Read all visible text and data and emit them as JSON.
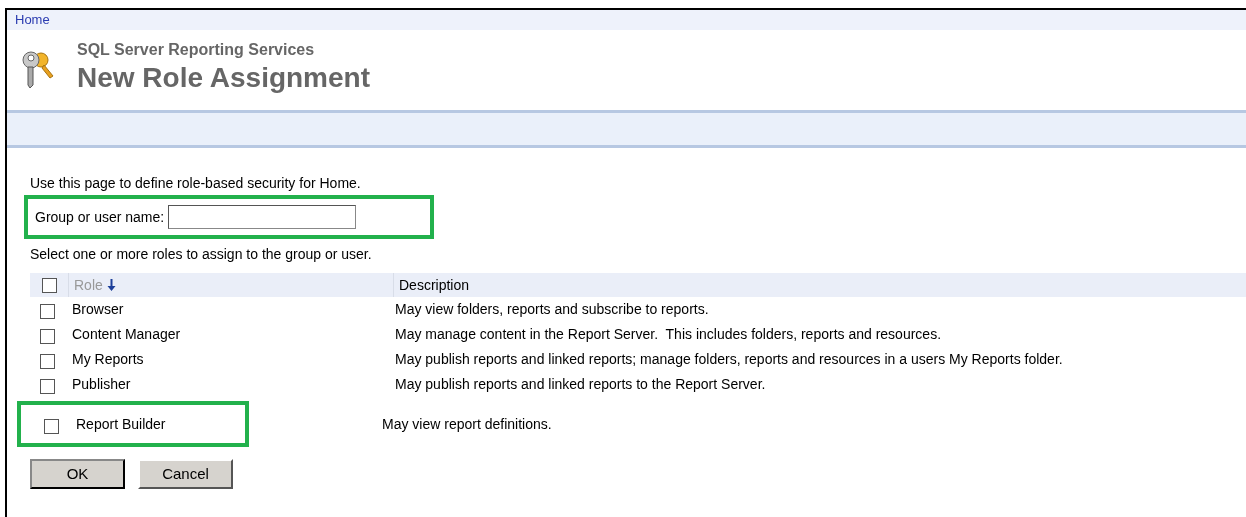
{
  "breadcrumb": "Home",
  "header": {
    "product": "SQL Server Reporting Services",
    "title": "New Role Assignment"
  },
  "intro": "Use this page to define role-based security for Home.",
  "user_field": {
    "label": "Group or user name:",
    "highlighted": true
  },
  "instruction": "Select one or more roles to assign to the group or user.",
  "table": {
    "select_all_checked": false,
    "columns": [
      {
        "label": "Role",
        "sorted": true
      },
      {
        "label": "Description",
        "sorted": false
      }
    ],
    "rows": [
      {
        "role": "Browser",
        "description": "May view folders, reports and subscribe to reports.",
        "checked": false,
        "highlighted": false
      },
      {
        "role": "Content Manager",
        "description": "May manage content in the Report Server.  This includes folders, reports and resources.",
        "checked": false,
        "highlighted": false
      },
      {
        "role": "My Reports",
        "description": "May publish reports and linked reports; manage folders, reports and resources in a users My Reports folder.",
        "checked": false,
        "highlighted": false
      },
      {
        "role": "Publisher",
        "description": "May publish reports and linked reports to the Report Server.",
        "checked": false,
        "highlighted": false
      },
      {
        "role": "Report Builder",
        "description": "May view report definitions.",
        "checked": false,
        "highlighted": true
      }
    ]
  },
  "buttons": [
    {
      "label": "OK",
      "kind": "primary"
    },
    {
      "label": "Cancel",
      "kind": "secondary"
    }
  ]
}
